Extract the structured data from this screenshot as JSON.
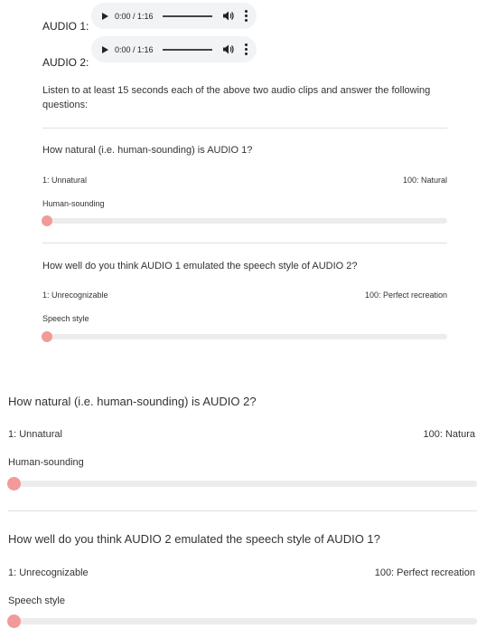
{
  "audio_players": [
    {
      "label": "AUDIO 1:",
      "time": "0:00 / 1:16"
    },
    {
      "label": "AUDIO 2:",
      "time": "0:00 / 1:16"
    }
  ],
  "instructions": "Listen to at least 15 seconds each of the above two audio clips and answer the following questions:",
  "questions": [
    {
      "title": "How natural (i.e. human-sounding) is AUDIO 1?",
      "min_label": "1: Unnatural",
      "max_label": "100: Natural",
      "slider_label": "Human-sounding",
      "value": 1
    },
    {
      "title": "How well do you think AUDIO 1 emulated the speech style of AUDIO 2?",
      "min_label": "1: Unrecognizable",
      "max_label": "100: Perfect recreation",
      "slider_label": "Speech style",
      "value": 1
    },
    {
      "title": "How natural (i.e. human-sounding) is AUDIO 2?",
      "min_label": "1: Unnatural",
      "max_label": "100: Natura",
      "slider_label": "Human-sounding",
      "value": 1
    },
    {
      "title": "How well do you think AUDIO 2 emulated the speech style of AUDIO 1?",
      "min_label": "1: Unrecognizable",
      "max_label": "100: Perfect recreation",
      "slider_label": "Speech style",
      "value": 1
    }
  ],
  "colors": {
    "slider_thumb": "#f29a9a",
    "slider_track": "#ececec",
    "player_bg": "#f1f3f4"
  },
  "icons": {
    "play": "play-icon",
    "volume": "volume-icon",
    "more": "more-options-icon"
  }
}
